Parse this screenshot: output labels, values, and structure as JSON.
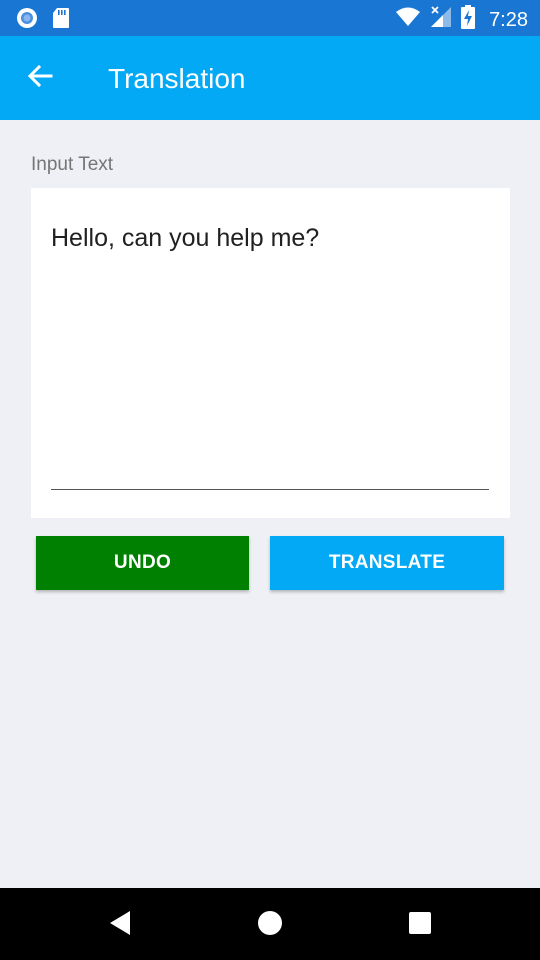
{
  "status_bar": {
    "time": "7:28",
    "icons": [
      "circle-notification-icon",
      "sd-card-icon",
      "wifi-icon",
      "signal-icon",
      "battery-charging-icon"
    ]
  },
  "app_bar": {
    "title": "Translation",
    "back_icon": "arrow-back-icon"
  },
  "input": {
    "label": "Input Text",
    "value": "Hello, can you help me?"
  },
  "buttons": {
    "undo": "UNDO",
    "translate": "TRANSLATE"
  },
  "nav_bar": {
    "icons": [
      "back-triangle-icon",
      "home-circle-icon",
      "recents-square-icon"
    ]
  },
  "colors": {
    "status_bar": "#1976D2",
    "app_bar": "#03A9F4",
    "undo_button": "#008000",
    "translate_button": "#03A9F4",
    "background": "#EEF0F5"
  }
}
